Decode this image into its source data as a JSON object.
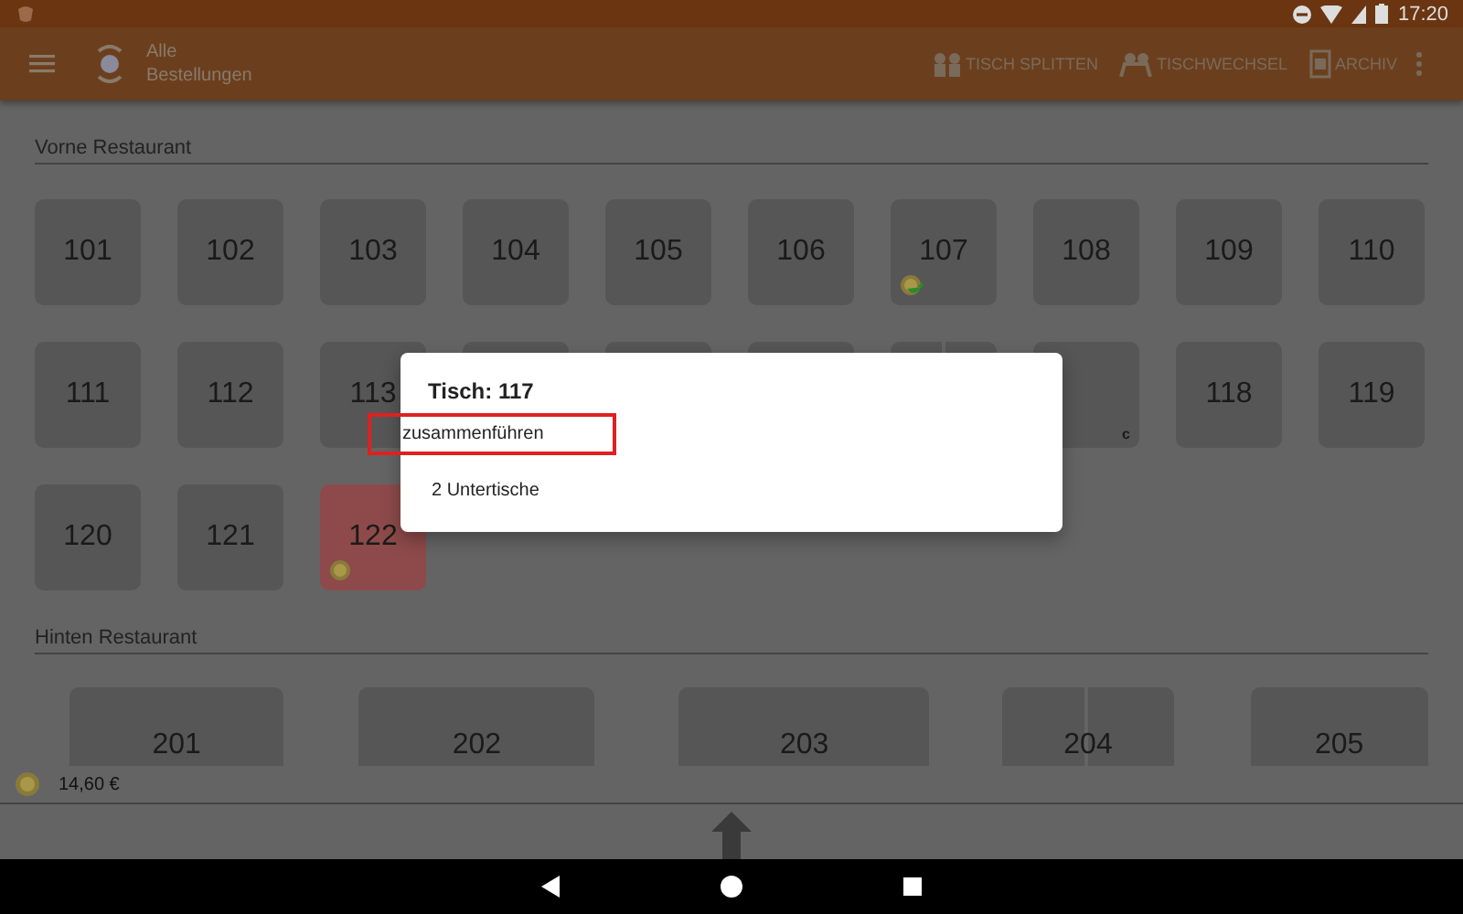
{
  "status_bar": {
    "time": "17:20"
  },
  "app_bar": {
    "title_lines": [
      "Alle",
      "Bestellungen"
    ],
    "actions": [
      {
        "label": "TISCH SPLITTEN",
        "kind": "split"
      },
      {
        "label": "TISCHWECHSEL",
        "kind": "swap"
      },
      {
        "label": "ARCHIV",
        "kind": "archive"
      }
    ]
  },
  "sections": [
    {
      "title": "Vorne Restaurant",
      "kind": "small",
      "tables": [
        {
          "label": "101",
          "occupied": false
        },
        {
          "label": "102",
          "occupied": false
        },
        {
          "label": "103",
          "occupied": false
        },
        {
          "label": "104",
          "occupied": false
        },
        {
          "label": "105",
          "occupied": false
        },
        {
          "label": "106",
          "occupied": false
        },
        {
          "label": "107",
          "occupied": false,
          "badge": {
            "kind": "coin-green"
          }
        },
        {
          "label": "108",
          "occupied": false
        },
        {
          "label": "109",
          "occupied": false
        },
        {
          "label": "110",
          "occupied": false
        },
        {
          "label": "111",
          "occupied": false
        },
        {
          "label": "112",
          "occupied": false
        },
        {
          "label": "113",
          "occupied": false
        },
        {
          "occupied": false
        },
        {
          "occupied": false
        },
        {
          "occupied": false
        },
        {
          "occupied": false,
          "split": true
        },
        {
          "occupied": false,
          "corner": "c"
        },
        {
          "label": "118",
          "occupied": false
        },
        {
          "label": "119",
          "occupied": false
        },
        {
          "label": "120",
          "occupied": false
        },
        {
          "label": "121",
          "occupied": false
        },
        {
          "label": "122",
          "occupied": true,
          "badge": {
            "kind": "coin"
          }
        }
      ]
    },
    {
      "title": "Hinten Restaurant",
      "kind": "wide",
      "tables": [
        {
          "label": "201",
          "occupied": false
        },
        {
          "label": "202",
          "occupied": false
        },
        {
          "label": "203",
          "occupied": false
        },
        {
          "label": "204",
          "occupied": false,
          "split": true
        },
        {
          "label": "205",
          "occupied": false
        }
      ]
    }
  ],
  "total": {
    "amount": "14,60 €"
  },
  "dialog": {
    "title": "Tisch: 117",
    "options": [
      {
        "label": "zusammenführen",
        "highlighted": true
      },
      {
        "label": "2 Untertische",
        "highlighted": false
      }
    ]
  }
}
